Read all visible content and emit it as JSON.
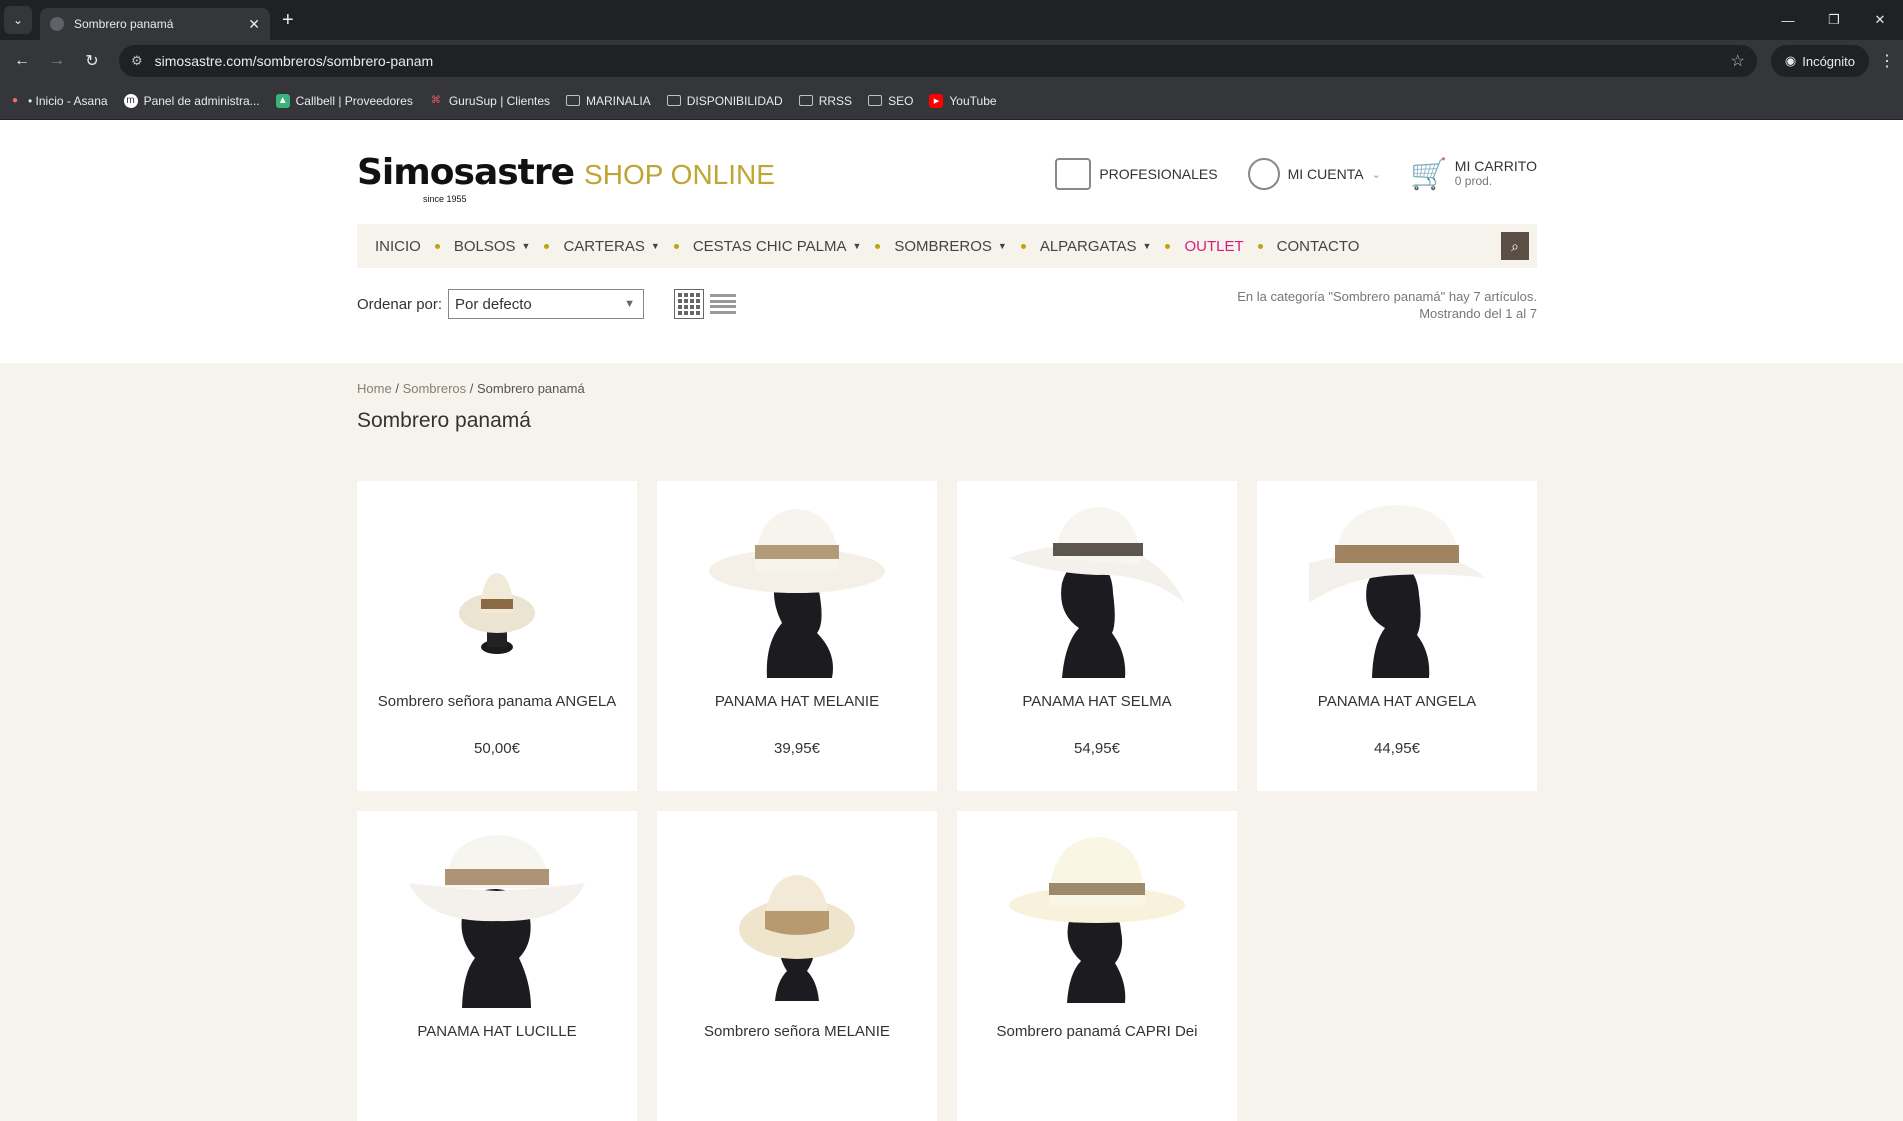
{
  "browser": {
    "tab_title": "Sombrero panamá",
    "url": "simosastre.com/sombreros/sombrero-panam",
    "incognito_label": "Incógnito",
    "bookmarks": [
      {
        "label": "• Inicio - Asana",
        "icon": "asana-icon"
      },
      {
        "label": "Panel de administra...",
        "icon": "m-icon"
      },
      {
        "label": "Callbell | Proveedores",
        "icon": "callbell-icon"
      },
      {
        "label": "GuruSup | Clientes",
        "icon": "gurusup-icon"
      },
      {
        "label": "MARINALIA",
        "icon": "folder-icon"
      },
      {
        "label": "DISPONIBILIDAD",
        "icon": "folder-icon"
      },
      {
        "label": "RRSS",
        "icon": "folder-icon"
      },
      {
        "label": "SEO",
        "icon": "folder-icon"
      },
      {
        "label": "YouTube",
        "icon": "youtube-icon"
      }
    ]
  },
  "header": {
    "brand": "Simosastre",
    "since": "since 1955",
    "shop": "SHOP ONLINE",
    "profesionales": "PROFESIONALES",
    "mi_cuenta": "MI CUENTA",
    "carrito": "MI CARRITO",
    "carrito_count": "0 prod."
  },
  "menu": {
    "items": [
      "INICIO",
      "BOLSOS",
      "CARTERAS",
      "CESTAS CHIC PALMA",
      "SOMBREROS",
      "ALPARGATAS",
      "OUTLET",
      "CONTACTO"
    ]
  },
  "sort": {
    "label": "Ordenar por:",
    "selected": "Por defecto"
  },
  "category_info": {
    "line1": "En la categoría \"Sombrero panamá\" hay 7 artículos.",
    "line2": "Mostrando del 1 al 7"
  },
  "breadcrumb": {
    "home": "Home",
    "sep": "/",
    "parent": "Sombreros",
    "current": "Sombrero panamá"
  },
  "page_title": "Sombrero panamá",
  "products": [
    {
      "name": "Sombrero señora panama ANGELA",
      "price": "50,00€"
    },
    {
      "name": "PANAMA HAT MELANIE",
      "price": "39,95€"
    },
    {
      "name": "PANAMA HAT SELMA",
      "price": "54,95€"
    },
    {
      "name": "PANAMA HAT ANGELA",
      "price": "44,95€"
    },
    {
      "name": "PANAMA HAT LUCILLE",
      "price": ""
    },
    {
      "name": "Sombrero señora MELANIE",
      "price": ""
    },
    {
      "name": "Sombrero panamá CAPRI Dei",
      "price": ""
    }
  ],
  "colors": {
    "accent_gold": "#bfa534",
    "outlet_pink": "#d81b7a",
    "menu_bg": "#f6f2ec"
  }
}
